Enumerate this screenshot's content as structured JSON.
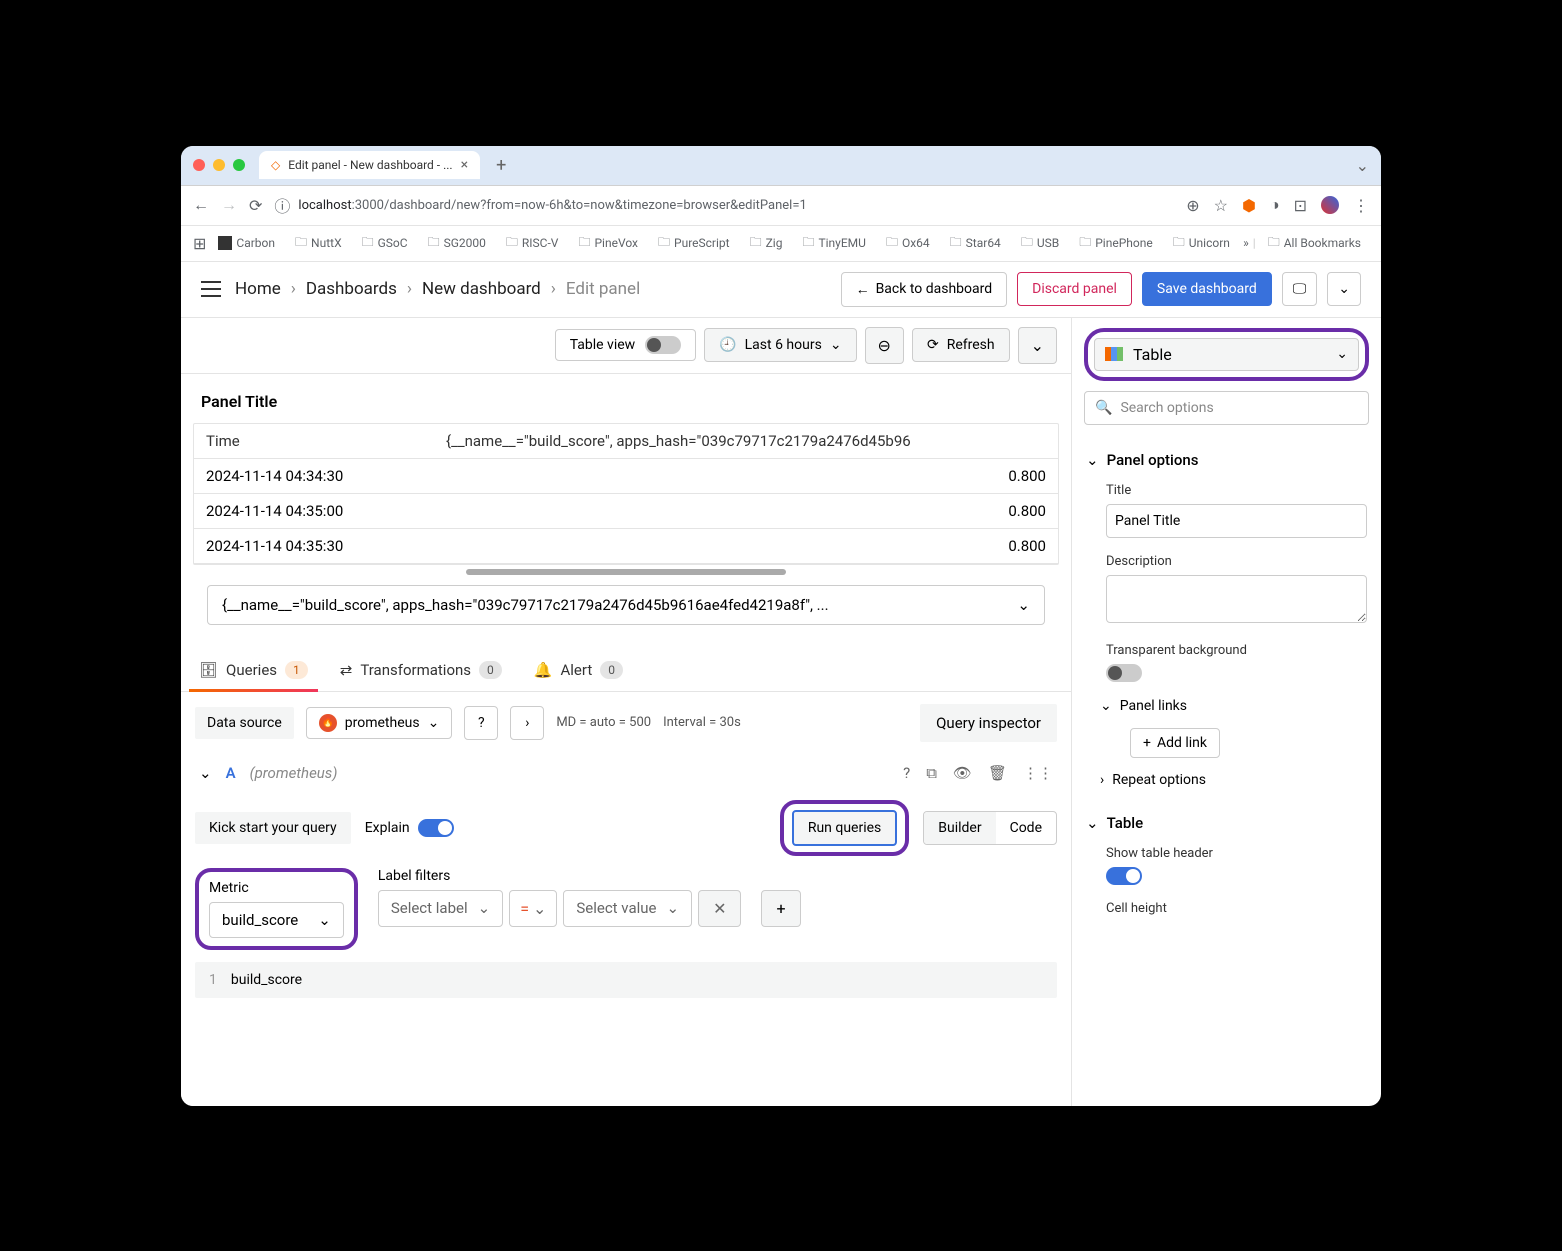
{
  "browser": {
    "tab_title": "Edit panel - New dashboard - ...",
    "url_domain": "localhost",
    "url_port": ":3000",
    "url_path": "/dashboard/new?from=now-6h&to=now&timezone=browser&editPanel=1",
    "bookmarks": [
      "Carbon",
      "NuttX",
      "GSoC",
      "SG2000",
      "RISC-V",
      "PineVox",
      "PureScript",
      "Zig",
      "TinyEMU",
      "Ox64",
      "Star64",
      "USB",
      "PinePhone",
      "Unicorn"
    ],
    "all_bookmarks": "All Bookmarks"
  },
  "breadcrumb": {
    "home": "Home",
    "dashboards": "Dashboards",
    "new": "New dashboard",
    "edit": "Edit panel"
  },
  "header": {
    "back": "Back to dashboard",
    "discard": "Discard panel",
    "save": "Save dashboard"
  },
  "toolbar": {
    "table_view": "Table view",
    "time_range": "Last 6 hours",
    "refresh": "Refresh"
  },
  "panel": {
    "title": "Panel Title",
    "col_time": "Time",
    "col_metric": "{__name__=\"build_score\", apps_hash=\"039c79717c2179a2476d45b96",
    "rows": [
      {
        "time": "2024-11-14 04:34:30",
        "val": "0.800"
      },
      {
        "time": "2024-11-14 04:35:00",
        "val": "0.800"
      },
      {
        "time": "2024-11-14 04:35:30",
        "val": "0.800"
      }
    ],
    "filter_text": "{__name__=\"build_score\", apps_hash=\"039c79717c2179a2476d45b9616ae4fed4219a8f\", ..."
  },
  "tabs": {
    "queries": "Queries",
    "queries_count": "1",
    "transformations": "Transformations",
    "trans_count": "0",
    "alert": "Alert",
    "alert_count": "0"
  },
  "query": {
    "ds_label": "Data source",
    "ds_name": "prometheus",
    "meta_md": "MD = auto = 500",
    "meta_interval": "Interval = 30s",
    "inspector": "Query inspector",
    "letter": "A",
    "name": "(prometheus)",
    "kickstart": "Kick start your query",
    "explain": "Explain",
    "run": "Run queries",
    "mode_builder": "Builder",
    "mode_code": "Code",
    "metric_label": "Metric",
    "metric_value": "build_score",
    "filters_label": "Label filters",
    "select_label": "Select label",
    "select_value": "Select value",
    "code_line": "1",
    "code_text": "build_score"
  },
  "side": {
    "viz": "Table",
    "search_ph": "Search options",
    "panel_options": "Panel options",
    "title_label": "Title",
    "title_value": "Panel Title",
    "desc_label": "Description",
    "transparent": "Transparent background",
    "panel_links": "Panel links",
    "add_link": "Add link",
    "repeat": "Repeat options",
    "table_section": "Table",
    "show_header": "Show table header",
    "cell_height": "Cell height"
  }
}
